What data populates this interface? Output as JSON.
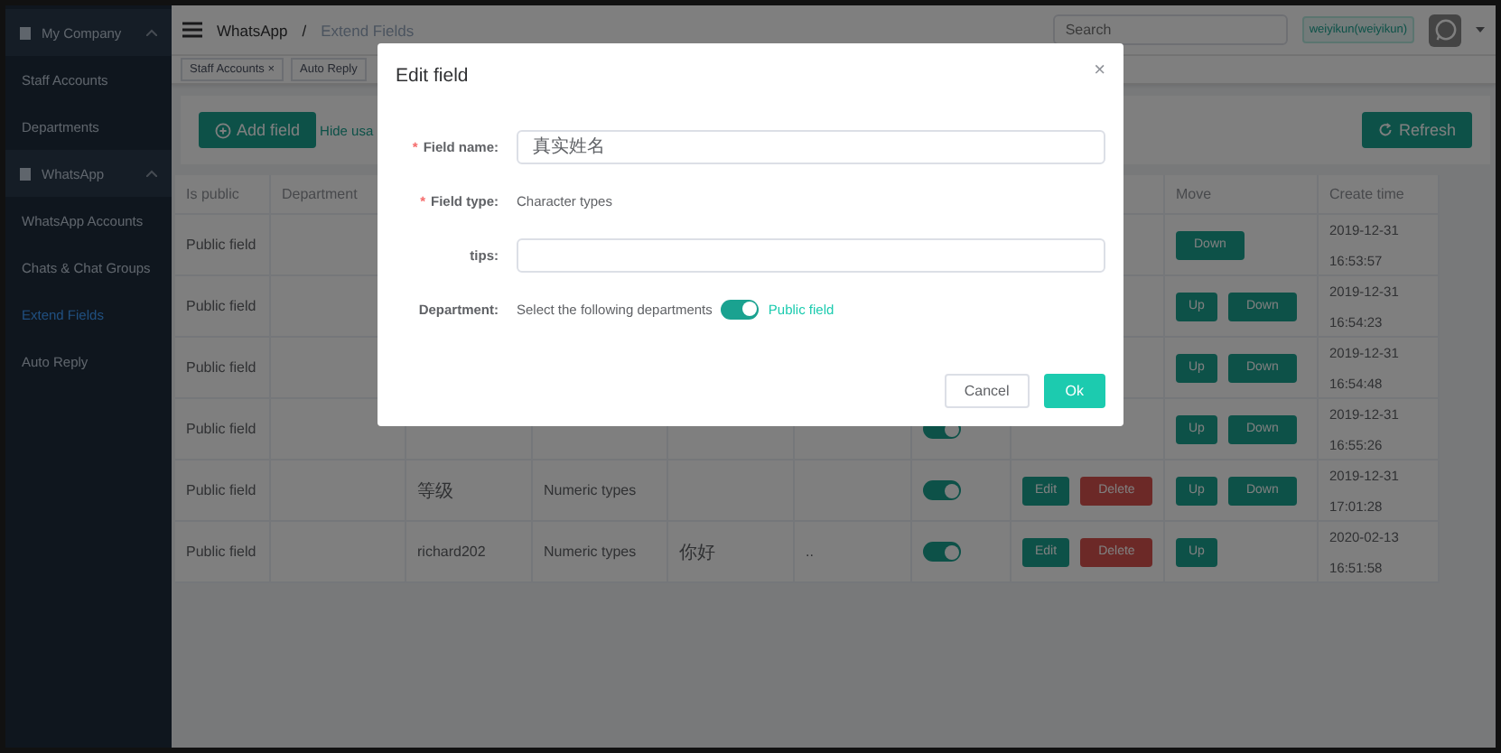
{
  "sidebar": {
    "items": [
      {
        "kind": "group",
        "label": "My Company",
        "expanded": true
      },
      {
        "kind": "link",
        "label": "Staff Accounts",
        "selected": false
      },
      {
        "kind": "link",
        "label": "Departments",
        "selected": false
      },
      {
        "kind": "group",
        "label": "WhatsApp",
        "expanded": true
      },
      {
        "kind": "link",
        "label": "WhatsApp Accounts",
        "selected": false
      },
      {
        "kind": "link",
        "label": "Chats & Chat Groups",
        "selected": false
      },
      {
        "kind": "link",
        "label": "Extend Fields",
        "selected": true
      },
      {
        "kind": "link",
        "label": "Auto Reply",
        "selected": false
      }
    ]
  },
  "breadcrumb": [
    "WhatsApp",
    "/",
    "Extend Fields"
  ],
  "search": {
    "placeholder": "Search"
  },
  "user": "weiyikun(weiyikun)",
  "tags": [
    {
      "label": "Staff Accounts",
      "close": "×"
    },
    {
      "label": "Auto Reply"
    }
  ],
  "toolbar": {
    "add": "Add field",
    "hide": "Hide usa",
    "refresh": "Refresh"
  },
  "headers": {
    "is_public": "Is public",
    "department": "Department",
    "move": "Move",
    "create_time": "Create time"
  },
  "rows": [
    {
      "is_public": "Public field",
      "move": [
        "Down"
      ],
      "date": "2019-12-31",
      "time": "16:53:57"
    },
    {
      "is_public": "Public field",
      "move": [
        "Up",
        "Down"
      ],
      "date": "2019-12-31",
      "time": "16:54:23"
    },
    {
      "is_public": "Public field",
      "move": [
        "Up",
        "Down"
      ],
      "date": "2019-12-31",
      "time": "16:54:48"
    },
    {
      "is_public": "Public field",
      "on": true,
      "move": [
        "Up",
        "Down"
      ],
      "date": "2019-12-31",
      "time": "16:55:26"
    },
    {
      "is_public": "Public field",
      "name": "等级",
      "type": "Numeric types",
      "on": true,
      "actions": [
        "Edit",
        "Delete"
      ],
      "move": [
        "Up",
        "Down"
      ],
      "date": "2019-12-31",
      "time": "17:01:28"
    },
    {
      "is_public": "Public field",
      "name": "richard202",
      "type": "Numeric types",
      "tips": "你好",
      "column_6": "..",
      "on": true,
      "actions": [
        "Edit",
        "Delete"
      ],
      "move": [
        "Up"
      ],
      "date": "2020-02-13",
      "time": "16:51:58"
    }
  ],
  "dialog": {
    "title": "Edit field",
    "close": "×",
    "fields": [
      {
        "kind": "input",
        "label": "Field name:",
        "required_mark": "*",
        "value": "真实姓名"
      },
      {
        "kind": "text",
        "label": "Field type:",
        "required_mark": "*",
        "value": "Character types"
      },
      {
        "kind": "input",
        "label": "tips:"
      },
      {
        "kind": "switch",
        "label": "Department:",
        "value": "Select the following departments",
        "on": true,
        "switch_label": "Public field"
      }
    ],
    "buttons": [
      {
        "kind": "default",
        "label": "Cancel"
      },
      {
        "kind": "primary",
        "label": "Ok"
      }
    ]
  }
}
